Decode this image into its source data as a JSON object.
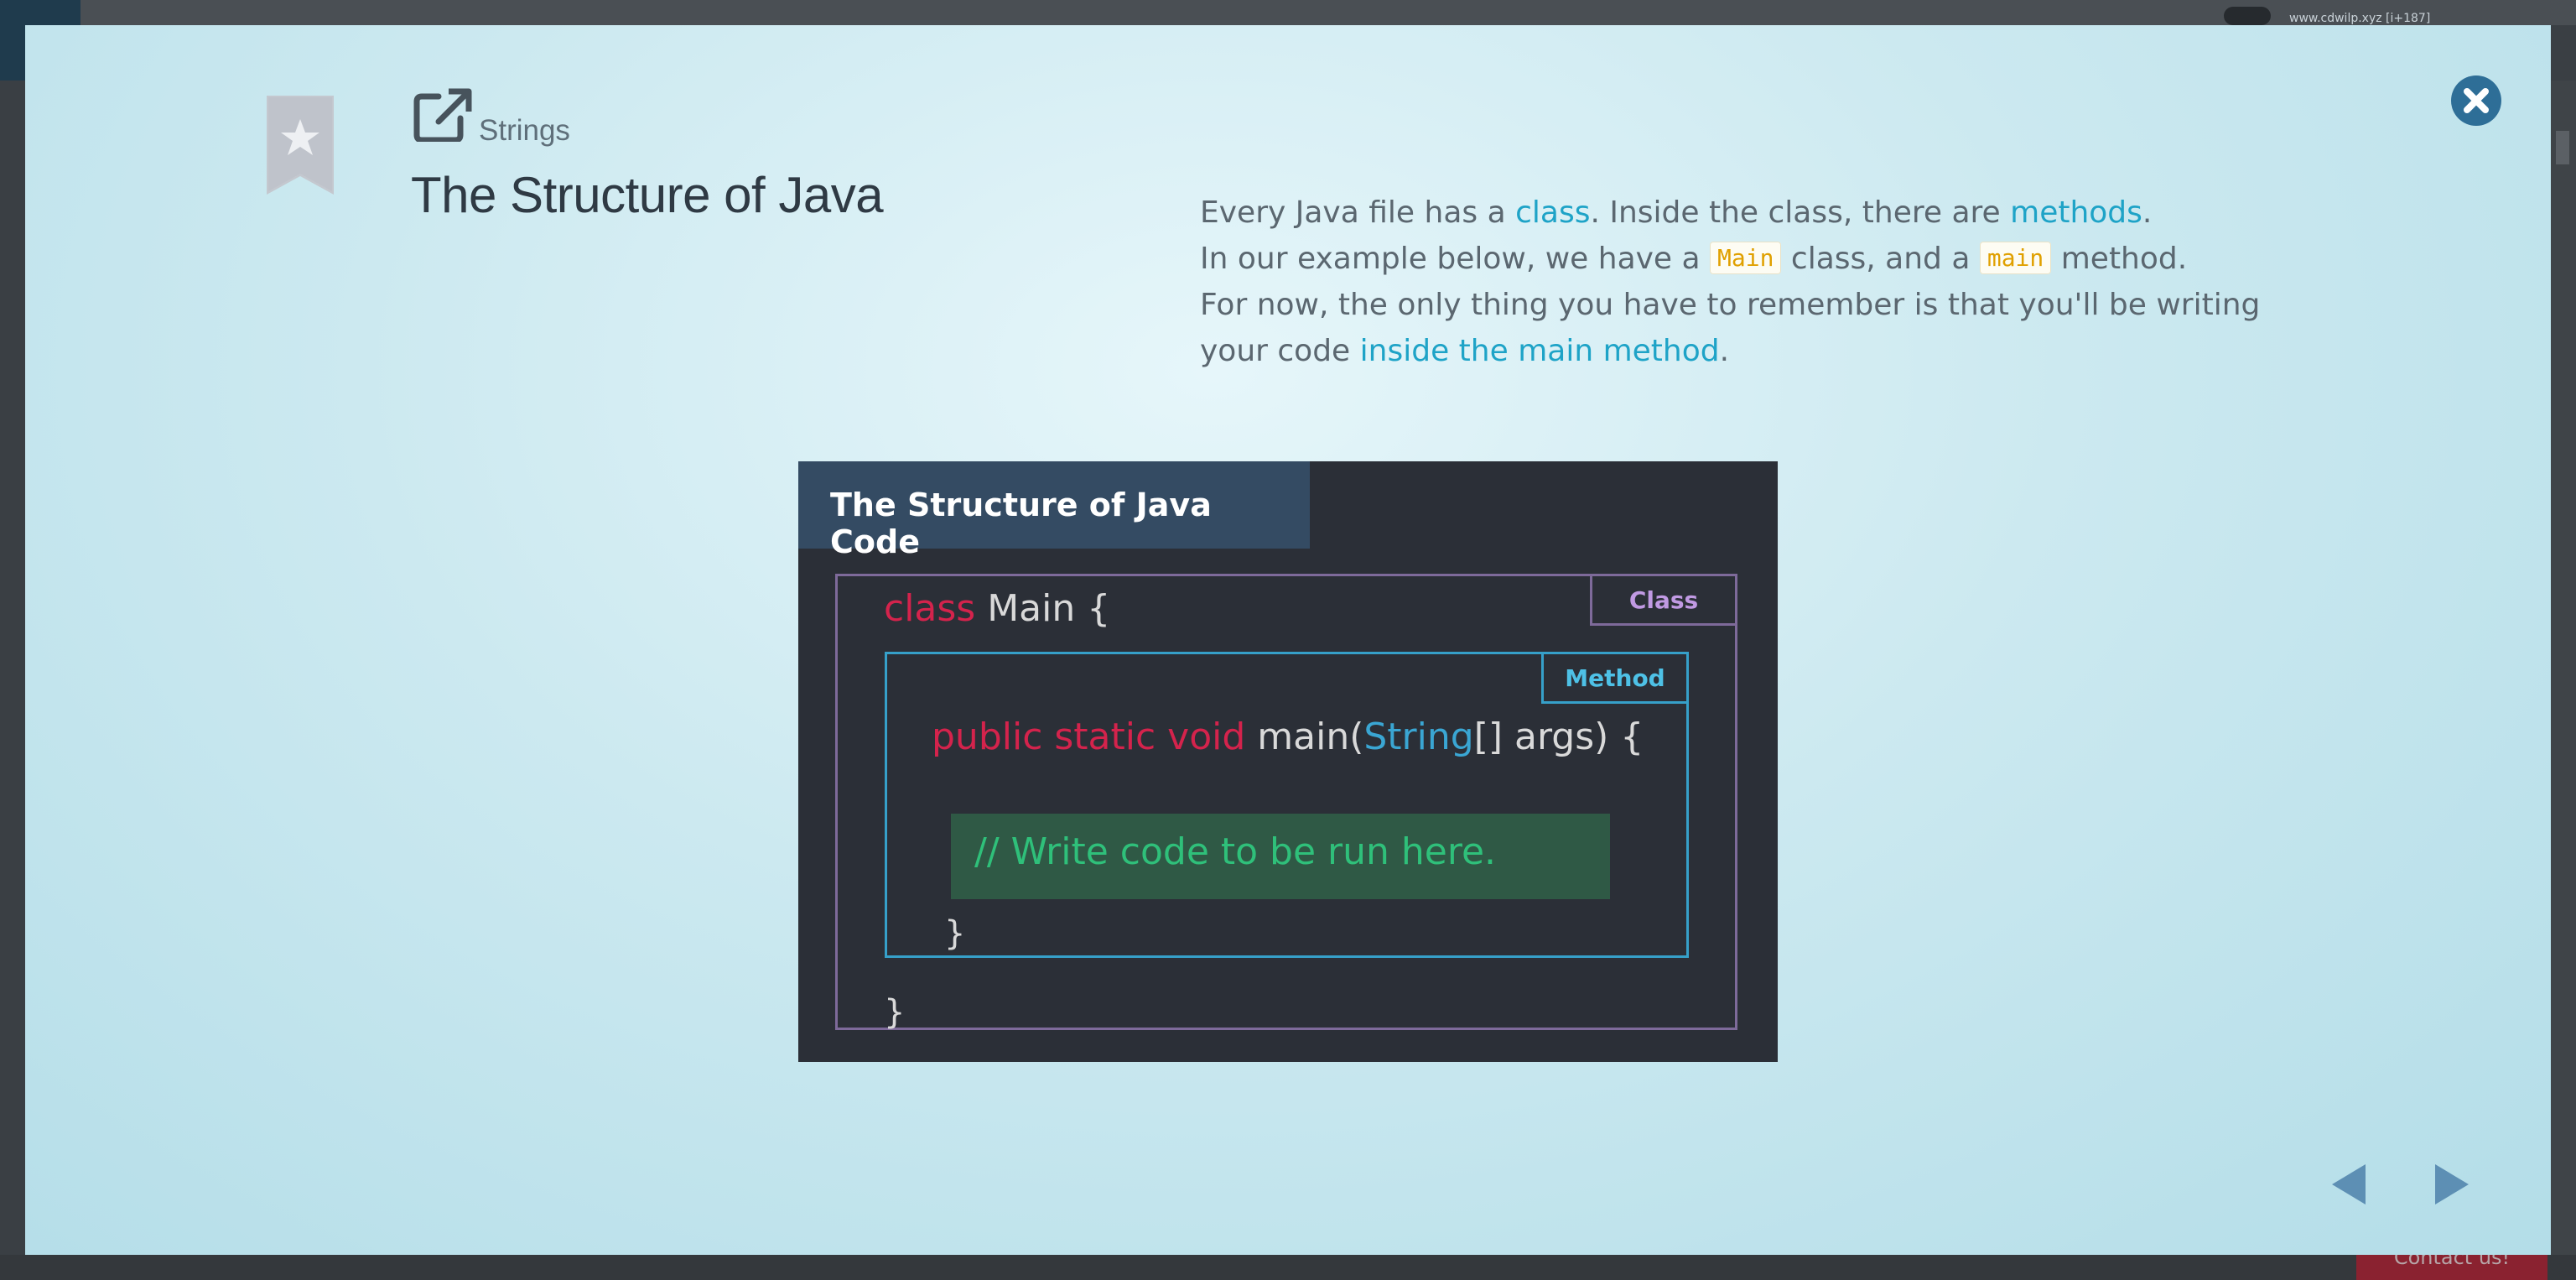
{
  "background": {
    "url_text": "www.cdwilp.xyz [i+187]",
    "contact_label": "Contact us!"
  },
  "modal": {
    "category": "Strings",
    "title": "The Structure of Java",
    "description": {
      "line1": {
        "t1": "Every Java file has a ",
        "link1": "class",
        "t2": ". Inside the class, there are ",
        "link2": "methods",
        "t3": "."
      },
      "line2": {
        "t1": "In our example below, we have a ",
        "code1": "Main",
        "t2": " class, and a ",
        "code2": "main",
        "t3": " method."
      },
      "line3": {
        "t1": "For now, the only thing you have to remember is that you'll be writing your code ",
        "link1": "inside the main method",
        "t2": "."
      }
    },
    "diagram": {
      "title": "The Structure of Java Code",
      "class_tag": "Class",
      "method_tag": "Method",
      "line_class": {
        "keyword": "class",
        "rest": " Main {"
      },
      "line_method": {
        "keywords": "public static void",
        "name": " main(",
        "type": "String",
        "rest": "[] args) {"
      },
      "comment": "// Write code to be run here.",
      "method_close": "}",
      "class_close": "}"
    },
    "icons": {
      "bookmark": "bookmark-star-icon",
      "external": "external-link-icon",
      "close": "close-icon",
      "prev": "previous-arrow-icon",
      "next": "next-arrow-icon"
    },
    "colors": {
      "link": "#1ea3c7",
      "keyword": "#d4234c",
      "type": "#3aa6d3",
      "comment": "#2fc07a",
      "class_border": "#7e6a9a",
      "method_border": "#36a0c9",
      "nav": "#5d8fb4"
    }
  }
}
